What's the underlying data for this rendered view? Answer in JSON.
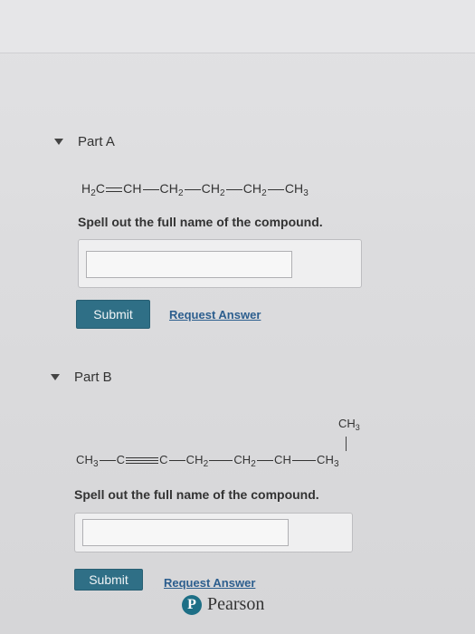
{
  "parts": [
    {
      "title": "Part A",
      "formula": {
        "g1": "H",
        "g1_sub": "2",
        "g1_tail": "C",
        "g2": "CH",
        "g3": "CH",
        "g3_sub": "2",
        "g4": "CH",
        "g4_sub": "2",
        "g5": "CH",
        "g5_sub": "2",
        "g6": "CH",
        "g6_sub": "3"
      },
      "instruction": "Spell out the full name of the compound.",
      "answer_value": "",
      "submit_label": "Submit",
      "request_label": "Request Answer"
    },
    {
      "title": "Part B",
      "branch": {
        "label": "CH",
        "sub": "3"
      },
      "formula": {
        "g1": "CH",
        "g1_sub": "3",
        "g2": "C",
        "g3": "C",
        "g4": "CH",
        "g4_sub": "2",
        "g5": "CH",
        "g5_sub": "2",
        "g6": "CH",
        "g7": "CH",
        "g7_sub": "3"
      },
      "instruction": "Spell out the full name of the compound.",
      "answer_value": "",
      "submit_label": "Submit",
      "request_label": "Request Answer"
    }
  ],
  "footer": {
    "brand": "Pearson",
    "logo_letter": "P"
  },
  "colors": {
    "submit": "#2f6f86",
    "link": "#2c5e8e"
  }
}
